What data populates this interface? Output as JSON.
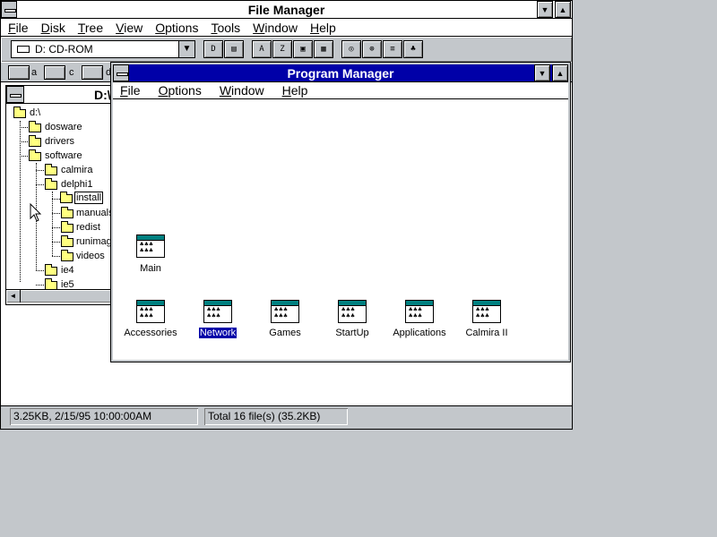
{
  "file_manager": {
    "title": "File Manager",
    "menu": [
      "File",
      "Disk",
      "Tree",
      "View",
      "Options",
      "Tools",
      "Window",
      "Help"
    ],
    "drive_select": "D: CD-ROM",
    "drives": [
      "a",
      "c",
      "d"
    ],
    "path_title": "D:\\",
    "tree": {
      "root": "d:\\",
      "items": [
        "dosware",
        "drivers",
        "software",
        "calmira",
        "delphi1",
        "install",
        "manuals",
        "redist",
        "runimage",
        "videos",
        "ie4",
        "ie5"
      ],
      "selected": "install"
    },
    "status_left": "3.25KB, 2/15/95 10:00:00AM",
    "status_right": "Total 16 file(s) (35.2KB)",
    "title_bar_color": "#ffffff"
  },
  "program_manager": {
    "title": "Program Manager",
    "menu": [
      "File",
      "Options",
      "Window",
      "Help"
    ],
    "groups": [
      "Main",
      "Accessories",
      "Network",
      "Games",
      "StartUp",
      "Applications",
      "Calmira II"
    ],
    "selected_group": "Network",
    "title_bar_color": "#0000a8"
  },
  "colors": {
    "desktop": "#c3c7cb",
    "active_title": "#0000a8",
    "highlight": "#0000a8"
  },
  "icons": {
    "system_menu": "system-menu-icon",
    "folder": "folder-icon",
    "program_group": "program-group-icon",
    "mouse_cursor": "arrow-cursor-icon"
  }
}
